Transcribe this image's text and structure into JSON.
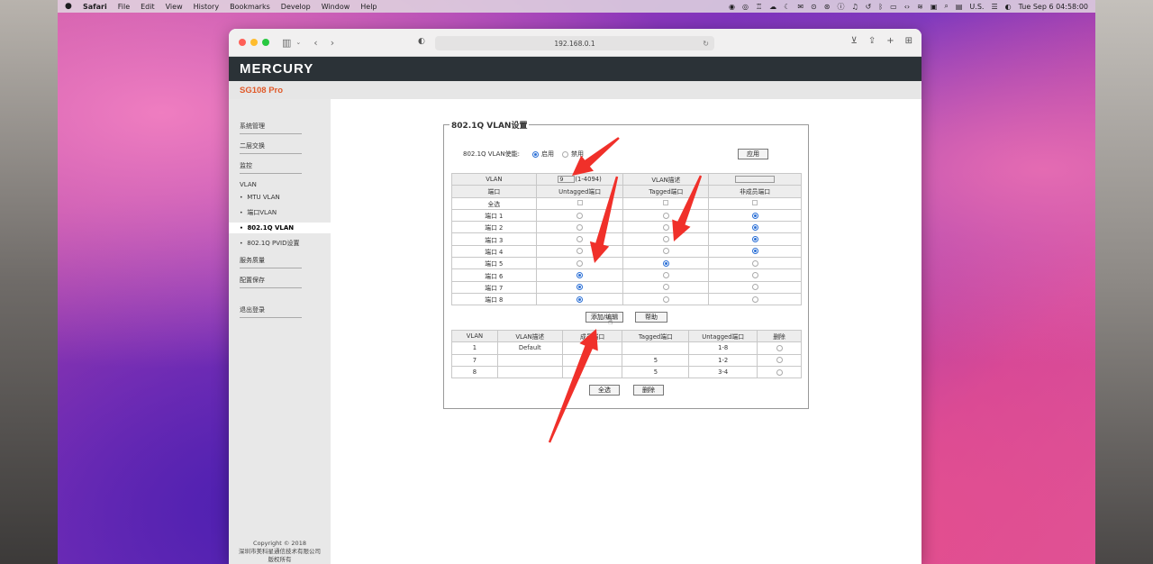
{
  "menubar": {
    "apple": "",
    "items": [
      "Safari",
      "File",
      "Edit",
      "View",
      "History",
      "Bookmarks",
      "Develop",
      "Window",
      "Help"
    ],
    "input_source": "U.S.",
    "clock": "Tue Sep 6  04:58:00"
  },
  "browser": {
    "url": "192.168.0.1"
  },
  "router": {
    "brand": "MERCURY",
    "model": "SG108 Pro",
    "nav": {
      "system": "系统管理",
      "l2": "二层交换",
      "monitor": "监控",
      "vlan": "VLAN",
      "mtu_vlan": "MTU VLAN",
      "port_vlan": "端口VLAN",
      "dot1q_vlan": "802.1Q VLAN",
      "pvid": "802.1Q PVID设置",
      "qos": "服务质量",
      "save": "配置保存",
      "logout": "退出登录"
    },
    "copyright": [
      "Copyright © 2018",
      "深圳市美科星通信技术有限公司",
      "版权所有"
    ],
    "panel": {
      "legend": "802.1Q VLAN设置",
      "enable_label": "802.1Q VLAN使能:",
      "enable_on": "启用",
      "enable_off": "禁用",
      "apply": "应用",
      "vlan_label": "VLAN",
      "vlan_value": "9",
      "vlan_range": "(1-4094)",
      "vlan_desc_label": "VLAN描述",
      "port_header": "端口",
      "untagged_header": "Untagged端口",
      "tagged_header": "Tagged端口",
      "nonmember_header": "非成员端口",
      "select_all": "全选",
      "ports": [
        {
          "name": "端口 1",
          "sel": "nonmember"
        },
        {
          "name": "端口 2",
          "sel": "nonmember"
        },
        {
          "name": "端口 3",
          "sel": "nonmember"
        },
        {
          "name": "端口 4",
          "sel": "nonmember"
        },
        {
          "name": "端口 5",
          "sel": "tagged"
        },
        {
          "name": "端口 6",
          "sel": "untagged"
        },
        {
          "name": "端口 7",
          "sel": "untagged"
        },
        {
          "name": "端口 8",
          "sel": "untagged"
        }
      ],
      "add_edit": "添加/编辑",
      "help": "帮助",
      "list_headers": [
        "VLAN",
        "VLAN描述",
        "成员端口",
        "Tagged端口",
        "Untagged端口",
        "删除"
      ],
      "list_rows": [
        {
          "vlan": "1",
          "desc": "Default",
          "members": "",
          "tagged": "",
          "untagged": "1-8"
        },
        {
          "vlan": "7",
          "desc": "",
          "members": "",
          "tagged": "5",
          "untagged": "1-2"
        },
        {
          "vlan": "8",
          "desc": "",
          "members": "",
          "tagged": "5",
          "untagged": "3-4"
        }
      ],
      "select_all_btn": "全选",
      "delete_btn": "删除"
    }
  },
  "colors": {
    "brand_bar": "#2b3237",
    "model_text": "#e05a2a",
    "radio_selected": "#2a6fd6",
    "annotation_arrow": "#f0302a"
  }
}
